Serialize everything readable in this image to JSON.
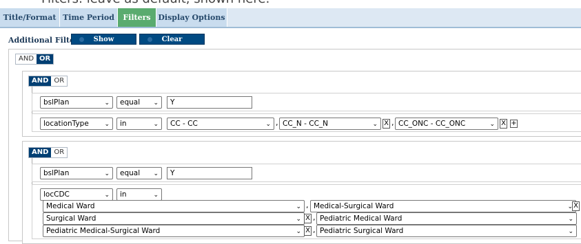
{
  "caption": "Filters: leave as default, shown here:",
  "tabs": [
    {
      "label": "Title/Format"
    },
    {
      "label": "Time Period"
    },
    {
      "label": "Filters"
    },
    {
      "label": "Display Options"
    }
  ],
  "additional_filters": {
    "label": "Additional Filters:",
    "show_label": "Show",
    "clear_label": "Clear"
  },
  "toggle": {
    "and": "AND",
    "or": "OR"
  },
  "group1": {
    "row1": {
      "field": "bslPlan",
      "op": "equal",
      "value": "Y"
    },
    "row2": {
      "field": "locationType",
      "op": "in",
      "values": [
        "CC - CC",
        "CC_N - CC_N",
        "CC_ONC - CC_ONC"
      ]
    }
  },
  "group2": {
    "row1": {
      "field": "bslPlan",
      "op": "equal",
      "value": "Y"
    },
    "row2": {
      "field": "locCDC",
      "op": "in",
      "values": [
        "Medical Ward",
        "Medical-Surgical Ward",
        "Surgical Ward",
        "Pediatric Medical Ward",
        "Pediatric Medical-Surgical Ward",
        "Pediatric Surgical Ward"
      ]
    }
  },
  "symbols": {
    "remove": "X",
    "add": "+",
    "comma": ",",
    "arrow": "⌄"
  }
}
